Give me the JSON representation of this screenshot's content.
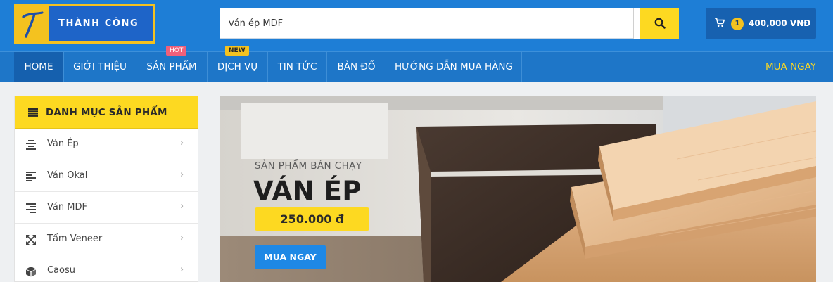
{
  "header": {
    "logo_letter": "T",
    "logo_text": "THÀNH CÔNG",
    "search": {
      "value": "ván ép MDF",
      "placeholder": ""
    },
    "cart": {
      "count": "1",
      "total": "400,000 VNĐ"
    }
  },
  "nav": {
    "items": [
      {
        "label": "HOME"
      },
      {
        "label": "GIỚI THIỆU"
      },
      {
        "label": "SẢN PHẨM",
        "badge": "HOT"
      },
      {
        "label": "DỊCH VỤ",
        "badge": "NEW"
      },
      {
        "label": "TIN TỨC"
      },
      {
        "label": "BẢN ĐỒ"
      },
      {
        "label": "HƯỚNG DẪN MUA HÀNG"
      }
    ],
    "cta": "MUA NGAY"
  },
  "sidebar": {
    "title": "DANH MỤC SẢN PHẨM",
    "items": [
      {
        "label": "Ván Ép",
        "icon": "align-center-icon"
      },
      {
        "label": "Ván Okal",
        "icon": "align-left-icon"
      },
      {
        "label": "Ván MDF",
        "icon": "align-right-icon"
      },
      {
        "label": "Tấm Veneer",
        "icon": "expand-arrows-icon"
      },
      {
        "label": "Caosu",
        "icon": "cube-icon"
      }
    ],
    "chevron": "›"
  },
  "banner": {
    "overline": "SẢN PHẨM BÁN CHẠY",
    "title": "VÁN ÉP",
    "price": "250.000 đ",
    "button": "MUA NGAY"
  },
  "colors": {
    "header_blue": "#1e7ed6",
    "nav_blue": "#1e76c8",
    "accent_yellow": "#fdd921",
    "cta_blue": "#1e88e5"
  }
}
